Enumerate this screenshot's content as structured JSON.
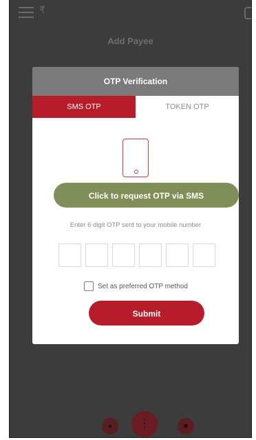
{
  "topbar": {
    "menu_icon": "hamburger-menu-icon",
    "brand_icon": "brand-logo-icon",
    "brand_glyph": "₹",
    "right_icon": "logout-icon"
  },
  "page": {
    "title": "Add Payee"
  },
  "modal": {
    "title": "OTP Verification",
    "tabs": [
      {
        "label": "SMS OTP",
        "active": true
      },
      {
        "label": "TOKEN OTP",
        "active": false
      }
    ],
    "phone_icon": "mobile-phone-icon",
    "request_button_label": "Click to request OTP via SMS",
    "otp_hint": "Enter 6 digit OTP sent to your mobile number",
    "otp_digits": [
      "",
      "",
      "",
      "",
      "",
      ""
    ],
    "preferred_label": "Set as preferred OTP method",
    "preferred_checked": false,
    "submit_label": "Submit"
  },
  "bottom_nav": {
    "left_icon": "accounts-icon",
    "center_icon": "grid-menu-icon",
    "right_icon": "cards-icon"
  },
  "colors": {
    "accent_red": "#b71c2a",
    "request_green": "#7f8f57",
    "header_gray": "#7a7a7a"
  }
}
